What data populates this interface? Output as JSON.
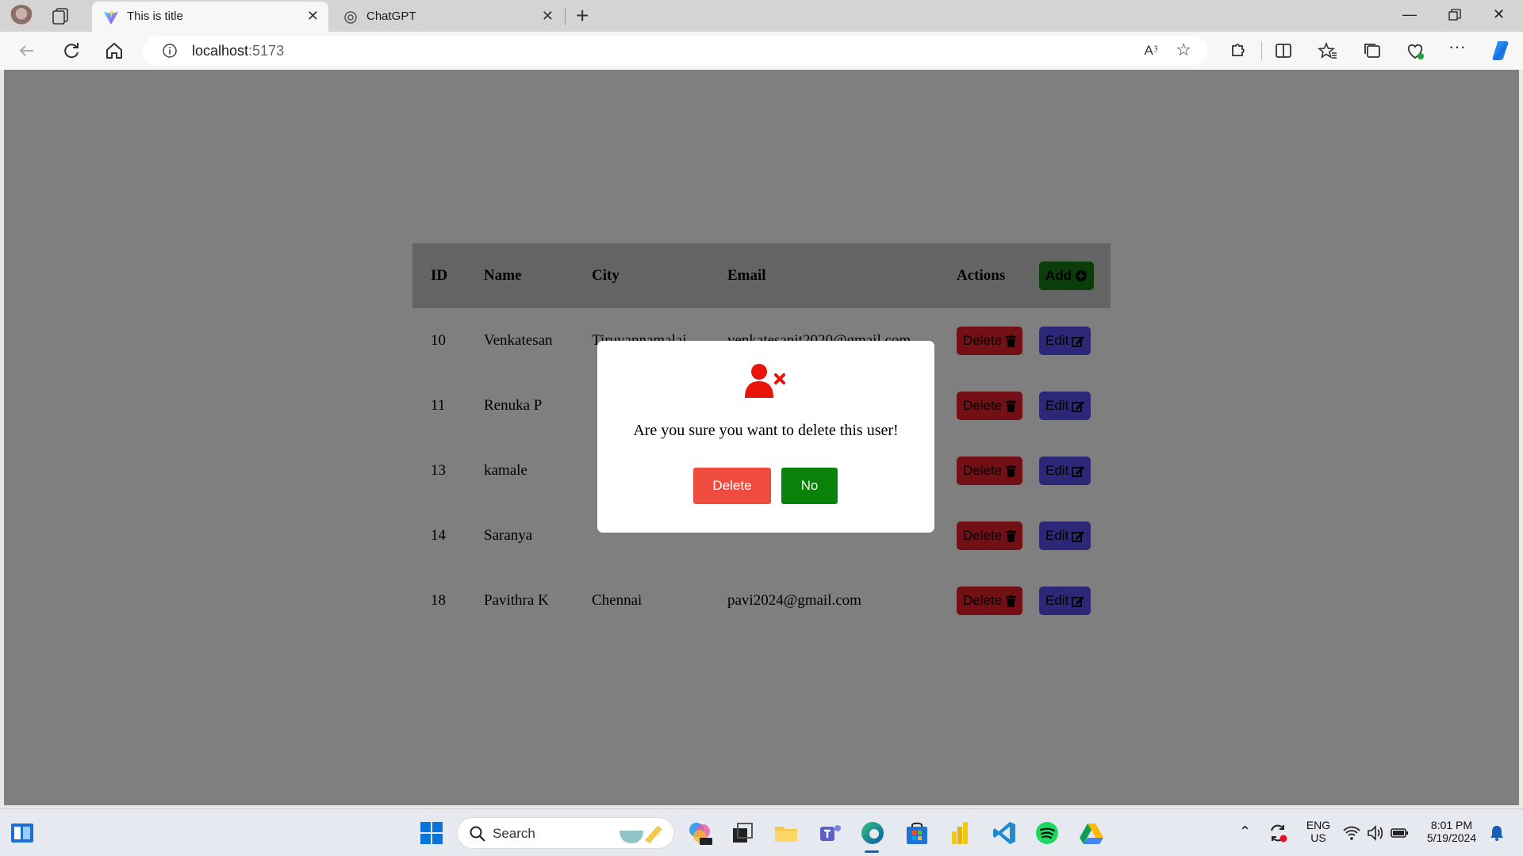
{
  "browser": {
    "tabs": [
      {
        "title": "This is title",
        "active": true
      },
      {
        "title": "ChatGPT",
        "active": false
      }
    ],
    "url_host": "localhost",
    "url_port": ":5173",
    "read_aloud": "A⁳"
  },
  "table": {
    "headers": {
      "id": "ID",
      "name": "Name",
      "city": "City",
      "email": "Email",
      "actions": "Actions"
    },
    "add_label": "Add",
    "delete_label": "Delete",
    "edit_label": "Edit",
    "rows": [
      {
        "id": "10",
        "name": "Venkatesan",
        "city": "Tiruvannamalai",
        "email": "venkatesanit2020@gmail.com"
      },
      {
        "id": "11",
        "name": "Renuka P",
        "city": "",
        "email": ""
      },
      {
        "id": "13",
        "name": "kamale",
        "city": "",
        "email": ""
      },
      {
        "id": "14",
        "name": "Saranya",
        "city": "",
        "email": ""
      },
      {
        "id": "18",
        "name": "Pavithra K",
        "city": "Chennai",
        "email": "pavi2024@gmail.com"
      }
    ]
  },
  "modal": {
    "message": "Are you sure you want to delete this user!",
    "delete_label": "Delete",
    "no_label": "No",
    "icon": "user-delete-icon",
    "icon_color": "#e8140a"
  },
  "taskbar": {
    "search_placeholder": "Search",
    "lang_top": "ENG",
    "lang_bottom": "US",
    "time": "8:01 PM",
    "date": "5/19/2024"
  }
}
